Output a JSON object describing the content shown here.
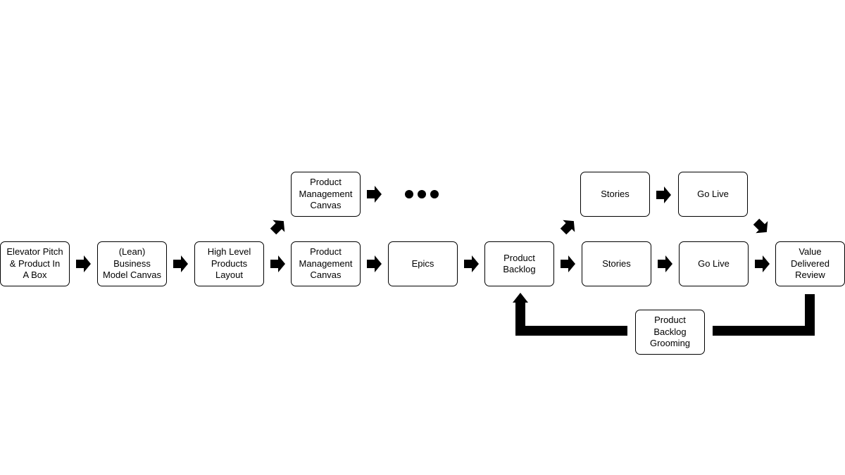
{
  "diagram": {
    "colors": {
      "stroke": "#000000",
      "fill": "#ffffff",
      "arrow": "#000000"
    },
    "main_flow": [
      {
        "id": "elevator",
        "label": "Elevator Pitch\n& Product In\nA Box"
      },
      {
        "id": "lean",
        "label": "(Lean)\nBusiness\nModel Canvas"
      },
      {
        "id": "highlevel",
        "label": "High Level\nProducts\nLayout"
      },
      {
        "id": "pmc",
        "label": "Product\nManagement\nCanvas"
      },
      {
        "id": "epics",
        "label": "Epics"
      },
      {
        "id": "backlog",
        "label": "Product\nBacklog"
      },
      {
        "id": "stories",
        "label": "Stories"
      },
      {
        "id": "golive",
        "label": "Go Live"
      },
      {
        "id": "value",
        "label": "Value\nDelivered\nReview"
      }
    ],
    "branch_pmc": {
      "label": "Product\nManagement\nCanvas",
      "continuation": "ellipsis"
    },
    "branch_stories": [
      {
        "id": "stories2",
        "label": "Stories"
      },
      {
        "id": "golive2",
        "label": "Go Live"
      }
    ],
    "feedback": {
      "label": "Product\nBacklog\nGrooming"
    }
  }
}
